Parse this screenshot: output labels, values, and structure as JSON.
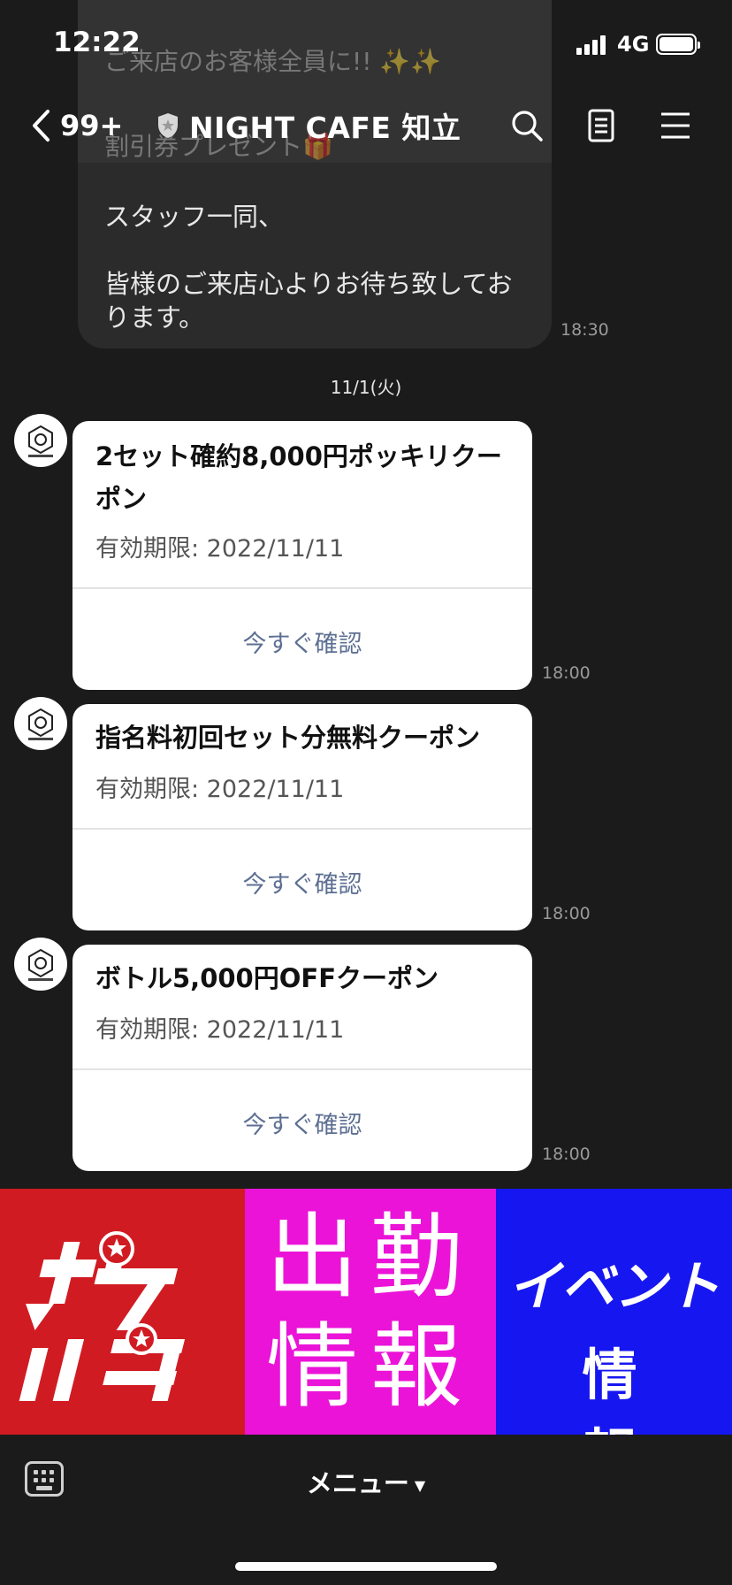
{
  "status_bar": {
    "time": "12:22",
    "network": "4G"
  },
  "header": {
    "back_count": "99+",
    "title": "NIGHT CAFE 知立"
  },
  "previous_message": {
    "faded_line1": "ご来店のお客様全員に!! ✨✨",
    "faded_line2": "割引券プレゼント🎁",
    "text": "スタッフ一同、\n\n皆様のご来店心よりお待ち致しております。",
    "time": "18:30"
  },
  "date_separator": "11/1(火)",
  "coupons": [
    {
      "title": "2セット確約8,000円ポッキリクーポン",
      "expiry": "有効期限: 2022/11/11",
      "button": "今すぐ確認",
      "time": "18:00"
    },
    {
      "title": "指名料初回セット分無料クーポン",
      "expiry": "有効期限: 2022/11/11",
      "button": "今すぐ確認",
      "time": "18:00"
    },
    {
      "title": "ボトル5,000円OFFクーポン",
      "expiry": "有効期限: 2022/11/11",
      "button": "今すぐ確認",
      "time": "18:00"
    }
  ],
  "rich_menu": {
    "pokepara": {
      "label": "ポケパラ",
      "color": "#d11b22"
    },
    "shukkin": {
      "line1": "出勤",
      "line2": "情報",
      "color": "#eb13d8"
    },
    "event": {
      "line1": "イベント",
      "line2": "情報",
      "color": "#1616f0"
    }
  },
  "bottom_bar": {
    "menu_label": "メニュー"
  },
  "icons": [
    "chevron-left-icon",
    "shield-icon",
    "search-icon",
    "notes-icon",
    "hamburger-menu-icon",
    "keyboard-icon"
  ]
}
